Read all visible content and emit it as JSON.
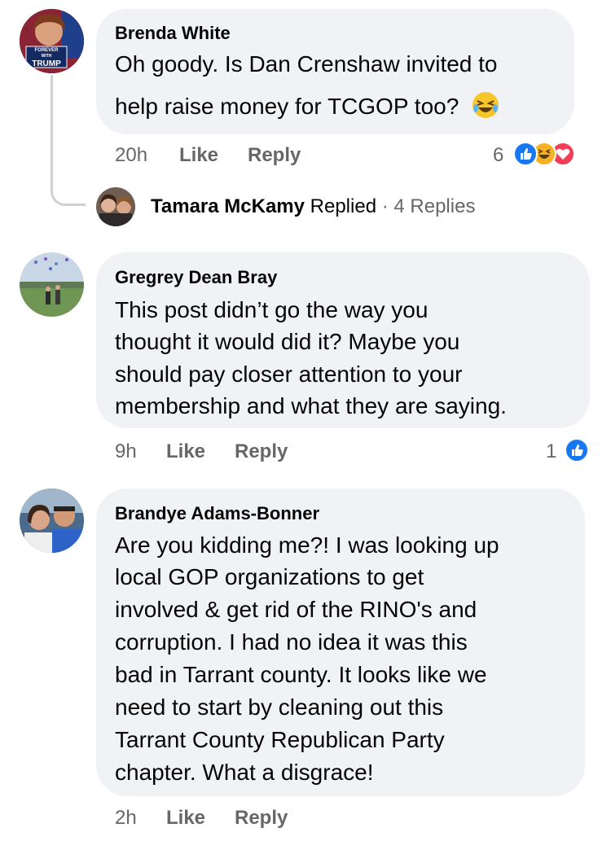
{
  "comments": [
    {
      "author": "Brenda White",
      "avatar_text": [
        "FOREVER",
        "WITH",
        "TRUMP"
      ],
      "lines": [
        "Oh goody. Is Dan Crenshaw invited to",
        "help raise money for TCGOP too?"
      ],
      "emoji": "😂",
      "time": "20h",
      "like_label": "Like",
      "reply_label": "Reply",
      "reaction_count": "6",
      "reactions": [
        "like-icon",
        "haha-icon",
        "love-icon"
      ],
      "replies": {
        "author": "Tamara McKamy",
        "action": "Replied",
        "separator": "·",
        "count": "4 Replies"
      }
    },
    {
      "author": "Gregrey Dean Bray",
      "lines": [
        "This post didn’t go the way you",
        "thought it would did it?  Maybe you",
        "should pay closer attention to your",
        "membership and what they are saying."
      ],
      "time": "9h",
      "like_label": "Like",
      "reply_label": "Reply",
      "reaction_count": "1",
      "reactions": [
        "like-icon"
      ]
    },
    {
      "author": "Brandye Adams-Bonner",
      "lines": [
        "Are you kidding me?!  I was looking up",
        "local GOP organizations to get",
        "involved & get rid of the RINO's and",
        "corruption.  I had no idea it was this",
        "bad in Tarrant county.  It looks like we",
        "need to start by cleaning out this",
        "Tarrant County Republican Party",
        "chapter.  What a disgrace!"
      ],
      "time": "2h",
      "like_label": "Like",
      "reply_label": "Reply"
    }
  ],
  "colors": {
    "bubble": "#f0f2f5",
    "meta": "#65676b",
    "like": "#1877f2",
    "love": "#f33e58",
    "haha": "#f7b125"
  }
}
